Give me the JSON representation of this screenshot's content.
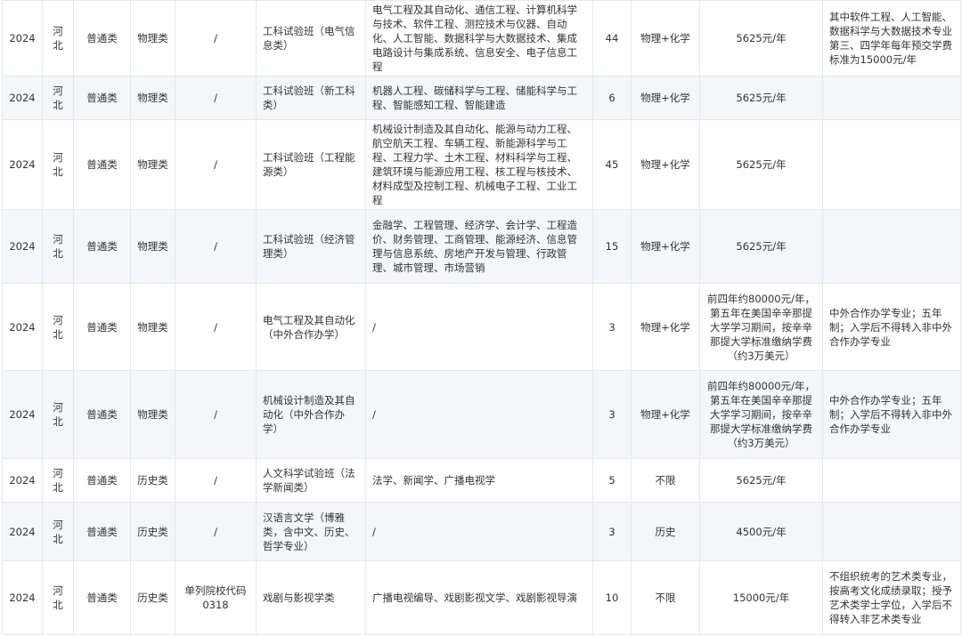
{
  "rows": [
    {
      "year": "2024",
      "province": "河北",
      "batch": "普通类",
      "category": "物理类",
      "code": "/",
      "major": "工科试验班（电气信息类）",
      "includes": "电气工程及其自动化、通信工程、计算机科学与技术、软件工程、测控技术与仪器、自动化、人工智能、数据科学与大数据技术、集成电路设计与集成系统、信息安全、电子信息工程",
      "plan": "44",
      "subjects": "物理+化学",
      "tuition": "5625元/年",
      "note": "其中软件工程、人工智能、数据科学与大数据技术专业第三、四学年每年预交学费标准为15000元/年"
    },
    {
      "year": "2024",
      "province": "河北",
      "batch": "普通类",
      "category": "物理类",
      "code": "/",
      "major": "工科试验班（新工科类）",
      "includes": "机器人工程、碳储科学与工程、储能科学与工程、智能感知工程、智能建造",
      "plan": "6",
      "subjects": "物理+化学",
      "tuition": "5625元/年",
      "note": ""
    },
    {
      "year": "2024",
      "province": "河北",
      "batch": "普通类",
      "category": "物理类",
      "code": "/",
      "major": "工科试验班（工程能源类）",
      "includes": "机械设计制造及其自动化、能源与动力工程、航空航天工程、车辆工程、新能源科学与工程、工程力学、土木工程、材料科学与工程、建筑环境与能源应用工程、核工程与核技术、材料成型及控制工程、机械电子工程、工业工程",
      "plan": "45",
      "subjects": "物理+化学",
      "tuition": "5625元/年",
      "note": ""
    },
    {
      "year": "2024",
      "province": "河北",
      "batch": "普通类",
      "category": "物理类",
      "code": "/",
      "major": "工科试验班（经济管理类）",
      "includes": "金融学、工程管理、经济学、会计学、工程造价、财务管理、工商管理、能源经济、信息管理与信息系统、房地产开发与管理、行政管理、城市管理、市场营销",
      "plan": "15",
      "subjects": "物理+化学",
      "tuition": "5625元/年",
      "note": ""
    },
    {
      "year": "2024",
      "province": "河北",
      "batch": "普通类",
      "category": "物理类",
      "code": "/",
      "major": "电气工程及其自动化（中外合作办学）",
      "includes": "/",
      "plan": "3",
      "subjects": "物理+化学",
      "tuition": "前四年约80000元/年，第五年在美国辛辛那提大学学习期间，按辛辛那提大学标准缴纳学费（约3万美元）",
      "note": "中外合作办学专业；五年制；入学后不得转入非中外合作办学专业"
    },
    {
      "year": "2024",
      "province": "河北",
      "batch": "普通类",
      "category": "物理类",
      "code": "/",
      "major": "机械设计制造及其自动化（中外合作办学）",
      "includes": "/",
      "plan": "3",
      "subjects": "物理+化学",
      "tuition": "前四年约80000元/年，第五年在美国辛辛那提大学学习期间，按辛辛那提大学标准缴纳学费（约3万美元）",
      "note": "中外合作办学专业；五年制；入学后不得转入非中外合作办学专业"
    },
    {
      "year": "2024",
      "province": "河北",
      "batch": "普通类",
      "category": "历史类",
      "code": "/",
      "major": "人文科学试验班（法学新闻类）",
      "includes": "法学、新闻学、广播电视学",
      "plan": "5",
      "subjects": "不限",
      "tuition": "5625元/年",
      "note": ""
    },
    {
      "year": "2024",
      "province": "河北",
      "batch": "普通类",
      "category": "历史类",
      "code": "/",
      "major": "汉语言文学（博雅类，含中文、历史、哲学专业）",
      "includes": "/",
      "plan": "3",
      "subjects": "历史",
      "tuition": "4500元/年",
      "note": ""
    },
    {
      "year": "2024",
      "province": "河北",
      "batch": "普通类",
      "category": "历史类",
      "code": "单列院校代码0318",
      "major": "戏剧与影视学类",
      "includes": "广播电视编导、戏剧影视文学、戏剧影视导演",
      "plan": "10",
      "subjects": "不限",
      "tuition": "15000元/年",
      "note": "不组织统考的艺术类专业，按高考文化成绩录取；授予艺术类学士学位，入学后不得转入非艺术类专业"
    }
  ]
}
